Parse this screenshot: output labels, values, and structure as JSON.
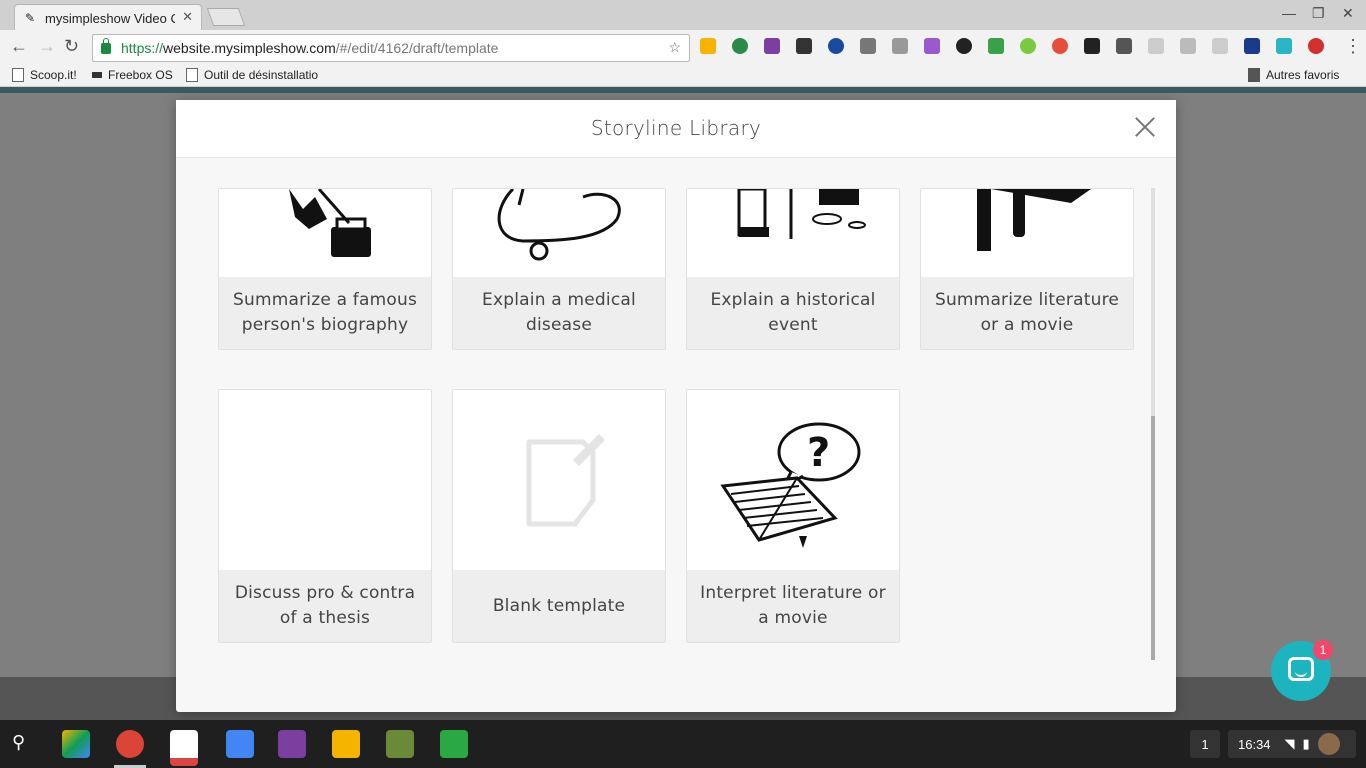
{
  "browser": {
    "tab_title": "mysimpleshow Video Cr",
    "tab_favicon": "mysimpleshow-icon",
    "url_scheme": "https://",
    "url_host": "website.mysimpleshow.com",
    "url_path": "/#/edit/4162/draft/template",
    "bookmarks": [
      {
        "label": "Scoop.it!"
      },
      {
        "label": "Freebox OS"
      },
      {
        "label": "Outil de désinstallatio"
      }
    ],
    "other_bookmarks": "Autres favoris"
  },
  "modal": {
    "title": "Storyline Library",
    "cards": [
      {
        "label": "Summarize a famous person's biography"
      },
      {
        "label": "Explain a medical disease"
      },
      {
        "label": "Explain a historical event"
      },
      {
        "label": "Summarize literature or a movie"
      },
      {
        "label": "Discuss pro & contra of a thesis"
      },
      {
        "label": "Blank template"
      },
      {
        "label": "Interpret literature or a movie"
      }
    ]
  },
  "chat": {
    "badge_count": "1"
  },
  "taskbar": {
    "workspace": "1",
    "clock": "16:34"
  },
  "colors": {
    "accent": "#1cb5bf",
    "badge": "#f2476a",
    "secure": "#1b8a3e"
  }
}
